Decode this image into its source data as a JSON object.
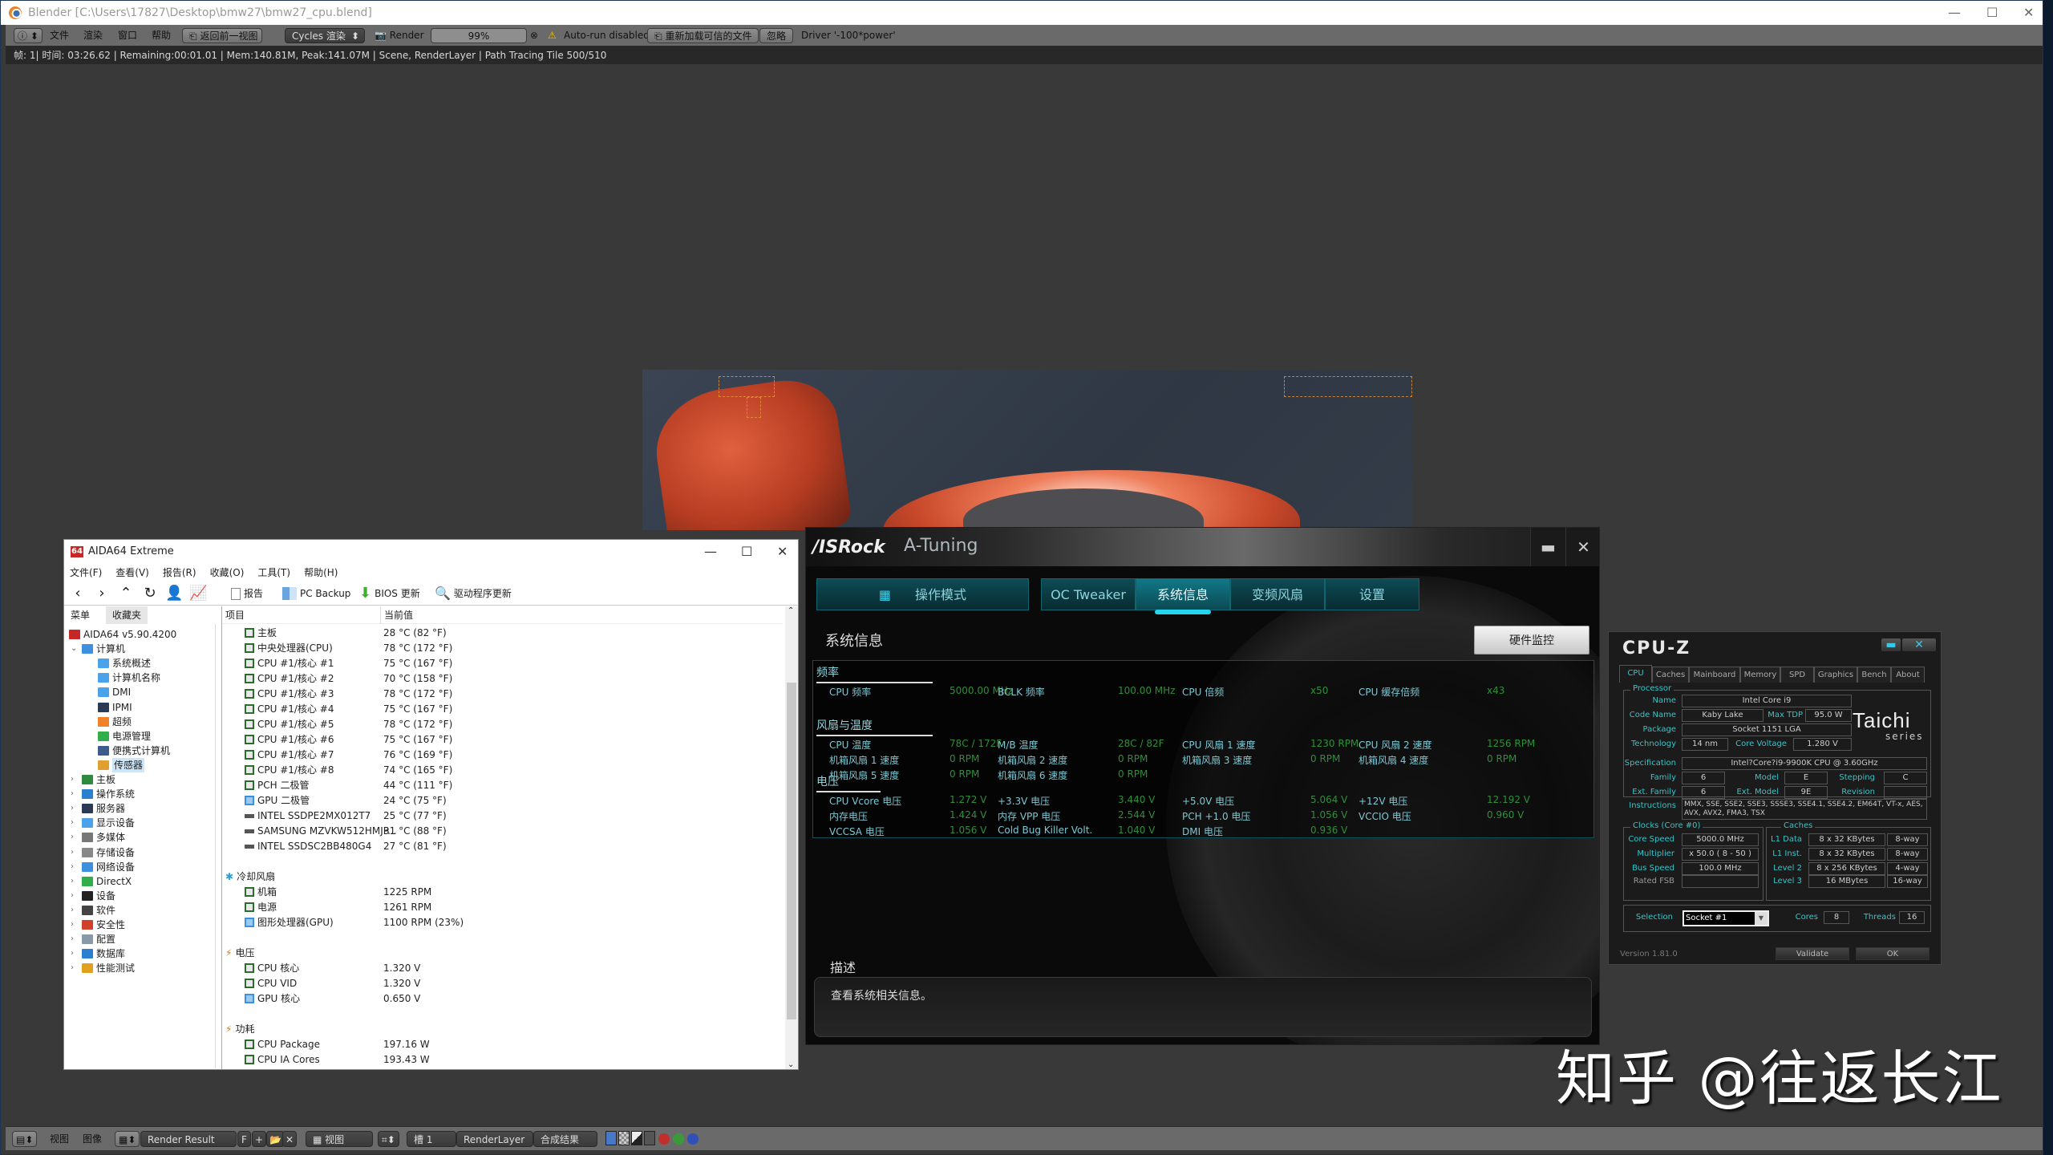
{
  "blender": {
    "title": "Blender [C:\\Users\\17827\\Desktop\\bmw27\\bmw27_cpu.blend]",
    "menus": [
      "文件",
      "渲染",
      "窗口",
      "帮助"
    ],
    "back_button": "返回前一视图",
    "engine": "Cycles 渲染",
    "render_label": "Render",
    "progress_text": "99%",
    "progress_fraction": 0.99,
    "autorun_warning": "Auto-run disabled",
    "reload_trusted": "重新加载可信的文件",
    "ignore": "忽略",
    "driver_text": "Driver '-100*power'",
    "info_line": "帧: 1| 时间: 03:26.62 | Remaining:00:01.01 | Mem:140.81M, Peak:141.07M | Scene, RenderLayer | Path Tracing Tile 500/510",
    "footer": {
      "view": "视图",
      "image": "图像",
      "image_name": "Render Result",
      "fake_user": "F",
      "view_select": "视图",
      "slot": "槽 1",
      "layer": "RenderLayer",
      "pass": "合成结果"
    }
  },
  "watermark": "知乎 @往返长江",
  "aida64": {
    "title": "AIDA64 Extreme",
    "menus": [
      "文件(F)",
      "查看(V)",
      "报告(R)",
      "收藏(O)",
      "工具(T)",
      "帮助(H)"
    ],
    "toolbar": {
      "report": "报告",
      "pc_backup": "PC Backup",
      "bios_update": "BIOS 更新",
      "driver_update": "驱动程序更新"
    },
    "tabs": [
      "菜单",
      "收藏夹"
    ],
    "tree": [
      {
        "label": "AIDA64 v5.90.4200",
        "level": 0,
        "icon": "aida64-logo-icon"
      },
      {
        "label": "计算机",
        "level": 1,
        "icon": "computer-icon",
        "expanded": true
      },
      {
        "label": "系统概述",
        "level": 2,
        "icon": "monitor-icon"
      },
      {
        "label": "计算机名称",
        "level": 2,
        "icon": "monitor-icon"
      },
      {
        "label": "DMI",
        "level": 2,
        "icon": "monitor-icon"
      },
      {
        "label": "IPMI",
        "level": 2,
        "icon": "server-icon"
      },
      {
        "label": "超频",
        "level": 2,
        "icon": "flame-icon"
      },
      {
        "label": "电源管理",
        "level": 2,
        "icon": "battery-icon"
      },
      {
        "label": "便携式计算机",
        "level": 2,
        "icon": "laptop-icon"
      },
      {
        "label": "传感器",
        "level": 2,
        "icon": "gauge-icon",
        "selected": true
      },
      {
        "label": "主板",
        "level": 1,
        "icon": "motherboard-icon"
      },
      {
        "label": "操作系统",
        "level": 1,
        "icon": "windows-icon"
      },
      {
        "label": "服务器",
        "level": 1,
        "icon": "server-icon"
      },
      {
        "label": "显示设备",
        "level": 1,
        "icon": "monitor-icon"
      },
      {
        "label": "多媒体",
        "level": 1,
        "icon": "speaker-icon"
      },
      {
        "label": "存储设备",
        "level": 1,
        "icon": "disk-icon"
      },
      {
        "label": "网络设备",
        "level": 1,
        "icon": "network-icon"
      },
      {
        "label": "DirectX",
        "level": 1,
        "icon": "xbox-icon"
      },
      {
        "label": "设备",
        "level": 1,
        "icon": "device-icon"
      },
      {
        "label": "软件",
        "level": 1,
        "icon": "software-icon"
      },
      {
        "label": "安全性",
        "level": 1,
        "icon": "shield-icon"
      },
      {
        "label": "配置",
        "level": 1,
        "icon": "config-icon"
      },
      {
        "label": "数据库",
        "level": 1,
        "icon": "database-icon"
      },
      {
        "label": "性能测试",
        "level": 1,
        "icon": "benchmark-icon"
      }
    ],
    "columns": [
      "项目",
      "当前值"
    ],
    "temperatures": [
      {
        "item": "主板",
        "value": "28 °C  (82 °F)"
      },
      {
        "item": "中央处理器(CPU)",
        "value": "78 °C  (172 °F)"
      },
      {
        "item": "CPU #1/核心 #1",
        "value": "75 °C  (167 °F)"
      },
      {
        "item": "CPU #1/核心 #2",
        "value": "70 °C  (158 °F)"
      },
      {
        "item": "CPU #1/核心 #3",
        "value": "78 °C  (172 °F)"
      },
      {
        "item": "CPU #1/核心 #4",
        "value": "75 °C  (167 °F)"
      },
      {
        "item": "CPU #1/核心 #5",
        "value": "78 °C  (172 °F)"
      },
      {
        "item": "CPU #1/核心 #6",
        "value": "75 °C  (167 °F)"
      },
      {
        "item": "CPU #1/核心 #7",
        "value": "76 °C  (169 °F)"
      },
      {
        "item": "CPU #1/核心 #8",
        "value": "74 °C  (165 °F)"
      },
      {
        "item": "PCH 二极管",
        "value": "44 °C  (111 °F)"
      },
      {
        "item": "GPU 二极管",
        "value": "24 °C  (75 °F)"
      },
      {
        "item": "INTEL SSDPE2MX012T7",
        "value": "25 °C  (77 °F)"
      },
      {
        "item": "SAMSUNG MZVKW512HMJP...",
        "value": "31 °C  (88 °F)"
      },
      {
        "item": "INTEL SSDSC2BB480G4",
        "value": "27 °C  (81 °F)"
      }
    ],
    "fan_section": "冷却风扇",
    "fans": [
      {
        "item": "机箱",
        "value": "1225 RPM"
      },
      {
        "item": "电源",
        "value": "1261 RPM"
      },
      {
        "item": "图形处理器(GPU)",
        "value": "1100 RPM  (23%)"
      }
    ],
    "voltage_section": "电压",
    "voltages": [
      {
        "item": "CPU 核心",
        "value": "1.320 V"
      },
      {
        "item": "CPU VID",
        "value": "1.320 V"
      },
      {
        "item": "GPU 核心",
        "value": "0.650 V"
      }
    ],
    "power_section": "功耗",
    "power": [
      {
        "item": "CPU Package",
        "value": "197.16 W"
      },
      {
        "item": "CPU IA Cores",
        "value": "193.43 W"
      }
    ]
  },
  "asrock": {
    "brand": "/ISRock",
    "title": "A-Tuning",
    "mode_tab": "操作模式",
    "tabs": [
      "OC Tweaker",
      "系统信息",
      "变频风扇",
      "设置"
    ],
    "active_tab": "系统信息",
    "page_title": "系统信息",
    "hw_monitor_button": "硬件监控",
    "groups": {
      "freq": "频率",
      "fan_temp": "风扇与温度",
      "voltage": "电压"
    },
    "freq": [
      {
        "label": "CPU 频率",
        "value": "5000.00 MHz"
      },
      {
        "label": "BCLK 频率",
        "value": "100.00 MHz"
      },
      {
        "label": "CPU 倍频",
        "value": "x50"
      },
      {
        "label": "CPU 缓存倍频",
        "value": "x43"
      }
    ],
    "fan_temp": [
      {
        "label": "CPU 温度",
        "value": "78C / 172F"
      },
      {
        "label": "M/B 温度",
        "value": "28C / 82F"
      },
      {
        "label": "CPU 风扇 1 速度",
        "value": "1230 RPM"
      },
      {
        "label": "CPU 风扇 2 速度",
        "value": "1256 RPM"
      },
      {
        "label": "机箱风扇 1 速度",
        "value": "0 RPM"
      },
      {
        "label": "机箱风扇 2 速度",
        "value": "0 RPM"
      },
      {
        "label": "机箱风扇 3 速度",
        "value": "0 RPM"
      },
      {
        "label": "机箱风扇 4 速度",
        "value": "0 RPM"
      },
      {
        "label": "机箱风扇 5 速度",
        "value": "0 RPM"
      },
      {
        "label": "机箱风扇 6 速度",
        "value": "0 RPM"
      }
    ],
    "voltage": [
      {
        "label": "CPU Vcore 电压",
        "value": "1.272 V"
      },
      {
        "label": "+3.3V 电压",
        "value": "3.440 V"
      },
      {
        "label": "+5.0V 电压",
        "value": "5.064 V"
      },
      {
        "label": "+12V 电压",
        "value": "12.192 V"
      },
      {
        "label": "内存电压",
        "value": "1.424 V"
      },
      {
        "label": "内存 VPP 电压",
        "value": "2.544 V"
      },
      {
        "label": "PCH +1.0 电压",
        "value": "1.056 V"
      },
      {
        "label": "VCCIO 电压",
        "value": "0.960 V"
      },
      {
        "label": "VCCSA 电压",
        "value": "1.056 V"
      },
      {
        "label": "Cold Bug Killer Volt.",
        "value": "1.040 V"
      },
      {
        "label": "DMI 电压",
        "value": "0.936 V"
      }
    ],
    "desc_title": "描述",
    "desc_text": "查看系统相关信息。"
  },
  "cpuz": {
    "title": "CPU-Z",
    "tabs": [
      "CPU",
      "Caches",
      "Mainboard",
      "Memory",
      "SPD",
      "Graphics",
      "Bench",
      "About"
    ],
    "processor_group": "Processor",
    "name_label": "Name",
    "name": "Intel Core i9",
    "codename_label": "Code Name",
    "codename": "Kaby Lake",
    "maxtdp_label": "Max TDP",
    "maxtdp": "95.0 W",
    "package_label": "Package",
    "package": "Socket 1151 LGA",
    "tech_label": "Technology",
    "tech": "14 nm",
    "corevolt_label": "Core Voltage",
    "corevolt": "1.280 V",
    "spec_label": "Specification",
    "spec": "Intel?Core?i9-9900K CPU @ 3.60GHz",
    "family_label": "Family",
    "family": "6",
    "model_label": "Model",
    "model": "E",
    "stepping_label": "Stepping",
    "stepping": "C",
    "extfamily_label": "Ext. Family",
    "extfamily": "6",
    "extmodel_label": "Ext. Model",
    "extmodel": "9E",
    "revision_label": "Revision",
    "revision": "",
    "instr_label": "Instructions",
    "instr": "MMX, SSE, SSE2, SSE3, SSSE3, SSE4.1, SSE4.2, EM64T, VT-x, AES, AVX, AVX2, FMA3, TSX",
    "brand_logo": "Taichi",
    "brand_sub": "series",
    "clocks_group": "Clocks (Core #0)",
    "corespeed_label": "Core Speed",
    "corespeed": "5000.0 MHz",
    "mult_label": "Multiplier",
    "mult": "x 50.0 ( 8 - 50 )",
    "bus_label": "Bus Speed",
    "bus": "100.0 MHz",
    "fsb_label": "Rated FSB",
    "fsb": "",
    "caches_group": "Caches",
    "l1d_label": "L1 Data",
    "l1d": "8 x 32 KBytes",
    "l1d_way": "8-way",
    "l1i_label": "L1 Inst.",
    "l1i": "8 x 32 KBytes",
    "l1i_way": "8-way",
    "l2_label": "Level 2",
    "l2": "8 x 256 KBytes",
    "l2_way": "4-way",
    "l3_label": "Level 3",
    "l3": "16 MBytes",
    "l3_way": "16-way",
    "selection_label": "Selection",
    "selection": "Socket #1",
    "cores_label": "Cores",
    "cores": "8",
    "threads_label": "Threads",
    "threads": "16",
    "version": "Version 1.81.0",
    "validate": "Validate",
    "ok": "OK"
  }
}
